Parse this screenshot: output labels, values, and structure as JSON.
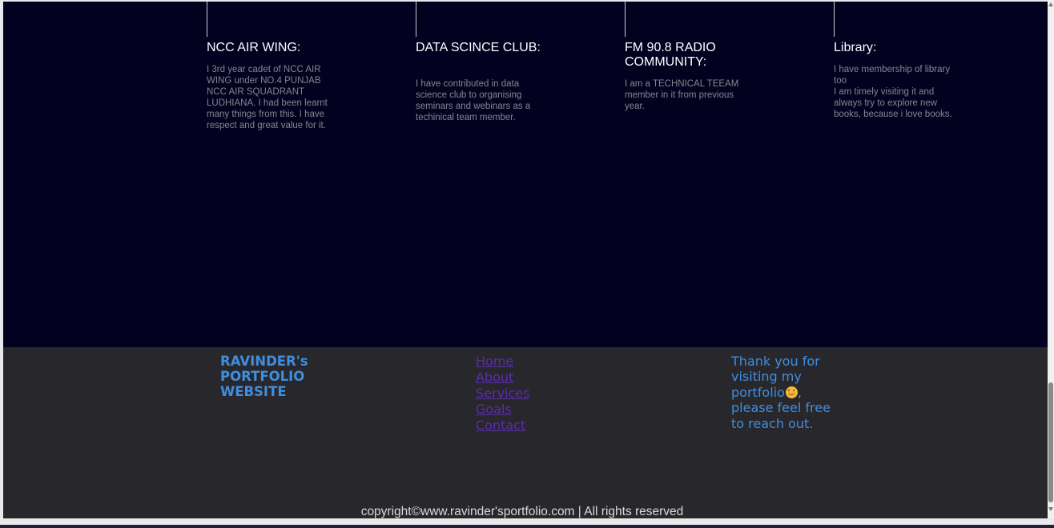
{
  "activities": [
    {
      "title": "NCC AIR WING:",
      "description": "I 3rd year cadet of NCC AIR WING under NO.4 PUNJAB NCC AIR SQUADRANT LUDHIANA. I had been learnt many things from this. I have respect and great value for it."
    },
    {
      "title": "DATA SCINCE CLUB:",
      "description": "I have contributed in data science club to organising seminars and webinars as a techinical team member."
    },
    {
      "title": "FM 90.8 RADIO COMMUNITY:",
      "description": "I am a TECHNICAL TEEAM member in it from previous year."
    },
    {
      "title": "Library:",
      "description": "I have membership of library too\nI am timely visiting it and always try to explore new books, because i love books."
    }
  ],
  "footer": {
    "brand": "RAVINDER's PORTFOLIO WEBSITE",
    "links": [
      "Home",
      "About",
      "Services",
      "Goals",
      "Contact"
    ],
    "thanks_before": "Thank you for visiting my portfolio",
    "thanks_icon": "smiley-face-icon",
    "thanks_after": ", please feel free to reach out.",
    "copyright": "copyright©www.ravinder'sportfolio.com | All rights reserved"
  },
  "colors": {
    "page_background": "#020220",
    "footer_background": "#28272b",
    "accent": "#3f8ee0",
    "link": "#5a2ea8"
  }
}
